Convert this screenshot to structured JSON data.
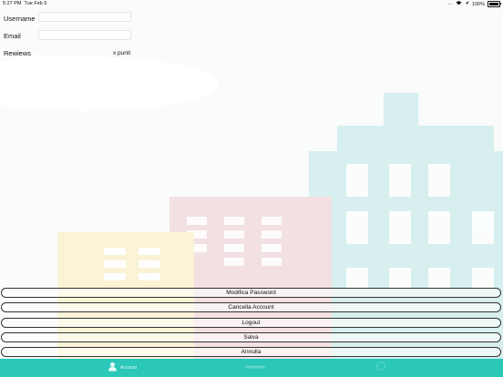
{
  "status_bar": {
    "time": "5:27 PM",
    "date": "Tue Feb 5",
    "battery": "100%"
  },
  "form": {
    "username_label": "Username",
    "username_value": "",
    "email_label": "Email",
    "email_value": "",
    "reviews_label": "Rewiews",
    "points_text": "x punti"
  },
  "buttons": {
    "change_password": "Modifica Password",
    "delete_account": "Cancella Account",
    "logout": "Logout",
    "save": "Salva",
    "cancel": "Annulla"
  },
  "tabbar": {
    "account_label": "Account",
    "accent_color": "#2bc7b9"
  }
}
